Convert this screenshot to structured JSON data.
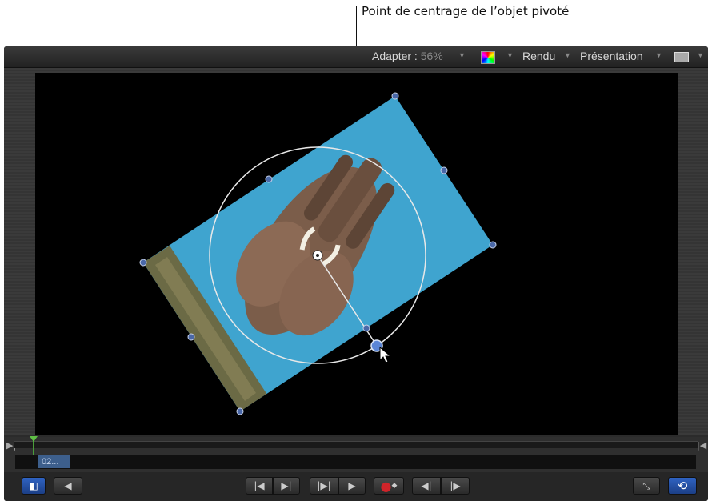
{
  "annotation": {
    "callout_text": "Point de centrage de l’objet pivoté"
  },
  "toolbar": {
    "fit_label": "Adapter :",
    "fit_value": "56%",
    "render_label": "Rendu",
    "view_label": "Présentation"
  },
  "timeline": {
    "clip_label": "02..."
  },
  "icons": {
    "color_channels": "color-wheel-icon",
    "monitor": "monitor-icon",
    "go_start": "go-to-start-icon",
    "go_end": "go-to-end-icon",
    "play_range": "play-range-icon",
    "play": "play-icon",
    "record": "record-icon",
    "prev_frame": "previous-frame-icon",
    "next_frame": "next-frame-icon",
    "fullscreen": "expand-icon",
    "loop": "loop-icon",
    "audio": "speaker-icon",
    "layers": "layers-panel-icon"
  },
  "colors": {
    "accent_blue": "#2f63c2",
    "sky": "#3fa4cf",
    "playhead": "#5fbf45",
    "record": "#d0242a"
  }
}
